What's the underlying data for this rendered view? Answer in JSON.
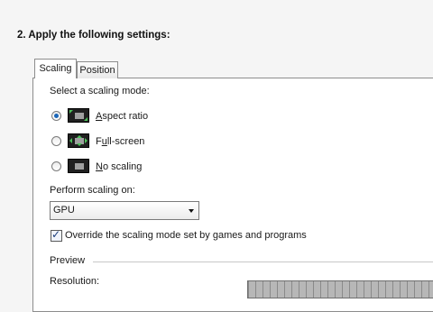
{
  "heading": "2. Apply the following settings:",
  "tabs": [
    {
      "label": "Scaling",
      "active": true
    },
    {
      "label": "Position",
      "active": false
    }
  ],
  "scaling_mode": {
    "label": "Select a scaling mode:",
    "options": [
      {
        "accesskey": "A",
        "rest": "spect ratio",
        "icon": "aspect-ratio-icon",
        "checked": true
      },
      {
        "prefix": "F",
        "accesskey": "u",
        "rest": "ll-screen",
        "icon": "full-screen-icon",
        "checked": false
      },
      {
        "accesskey": "N",
        "rest": "o scaling",
        "icon": "no-scaling-icon",
        "checked": false
      }
    ]
  },
  "perform_scaling": {
    "label": "Perform scaling on:",
    "selected": "GPU"
  },
  "override": {
    "label": "Override the scaling mode set by games and programs",
    "checked": true
  },
  "preview": {
    "label": "Preview",
    "resolution_label": "Resolution:"
  },
  "colors": {
    "accent": "#1b66b8",
    "icon_arrow": "#4cc35a"
  }
}
